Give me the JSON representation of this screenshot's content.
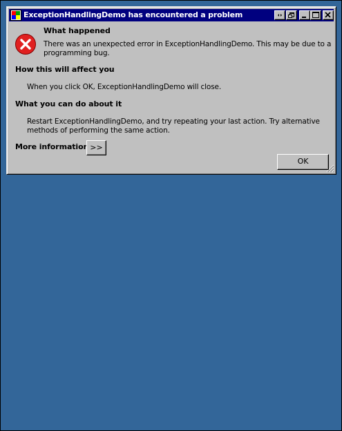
{
  "window": {
    "title": "ExceptionHandlingDemo has encountered a problem"
  },
  "sections": {
    "what_happened_heading": "What happened",
    "what_happened_line1": "There was an unexpected error in ExceptionHandlingDemo. This may be due to a",
    "what_happened_line2": "programming bug.",
    "affect_heading": "How this will affect you",
    "affect_body": "When you click OK, ExceptionHandlingDemo will close.",
    "do_heading": "What you can do about it",
    "do_line1": "Restart ExceptionHandlingDemo, and try repeating your last action. Try alternative",
    "do_line2": "methods of performing the same action.",
    "more_label": "More information"
  },
  "buttons": {
    "more": ">>",
    "ok": "OK"
  },
  "colors": {
    "desktop": "#336699",
    "titlebar": "#00007f",
    "dialog": "#c0c0c0",
    "error_red": "#e02020"
  },
  "icons": {
    "app": "app-icon",
    "error": "error-icon",
    "help": "help-icon",
    "restore": "restore-icon",
    "minimize": "minimize-icon",
    "maximize": "maximize-icon",
    "close": "close-icon",
    "size_grip": "size-grip-icon"
  }
}
